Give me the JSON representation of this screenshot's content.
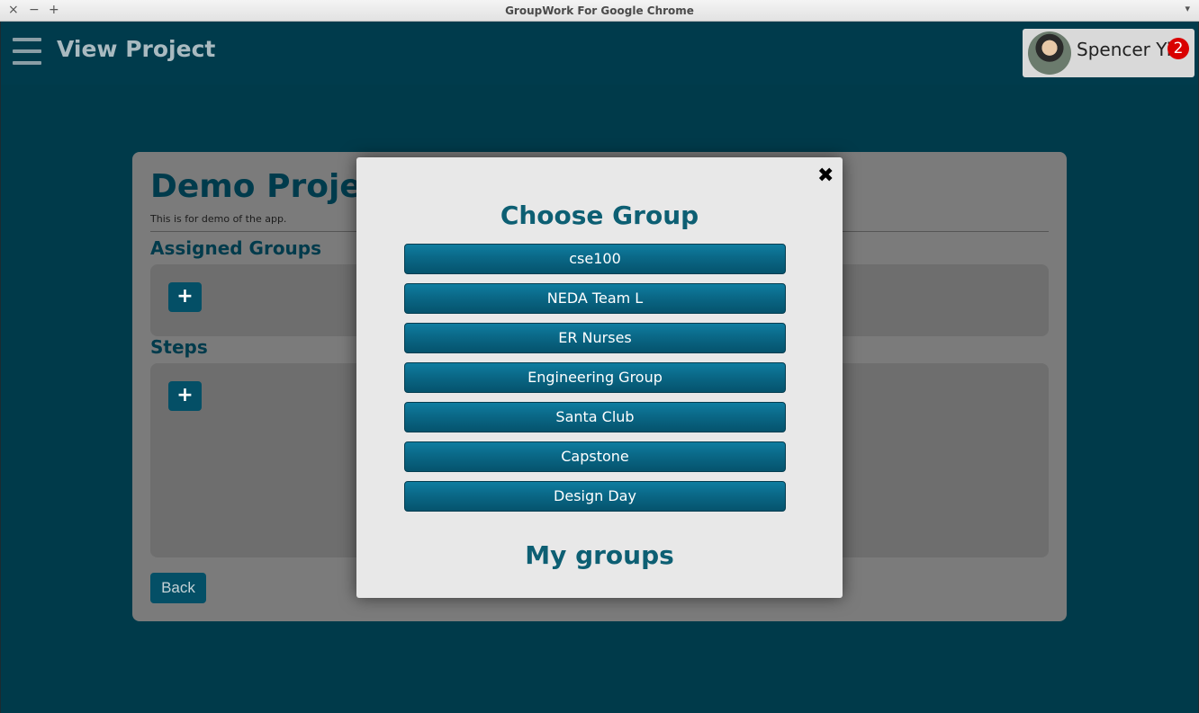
{
  "window": {
    "title": "GroupWork For Google Chrome",
    "close_glyph": "×",
    "minimize_glyph": "−",
    "maximize_glyph": "+",
    "menu_glyph": "▾"
  },
  "header": {
    "title": "View Project",
    "user_name": "Spencer Yi",
    "notification_count": "2"
  },
  "project": {
    "title": "Demo Project",
    "description": "This is for demo of the app.",
    "assigned_groups_label": "Assigned Groups",
    "steps_label": "Steps",
    "add_label": "+",
    "back_label": "Back"
  },
  "modal": {
    "title": "Choose Group",
    "close_glyph": "✖",
    "groups": [
      "cse100",
      "NEDA Team L",
      "ER Nurses",
      "Engineering Group",
      "Santa Club",
      "Capstone",
      "Design Day"
    ],
    "footer_title": "My groups"
  },
  "colors": {
    "background": "#003a4a",
    "accent": "#0a6887",
    "badge": "#d90000"
  }
}
